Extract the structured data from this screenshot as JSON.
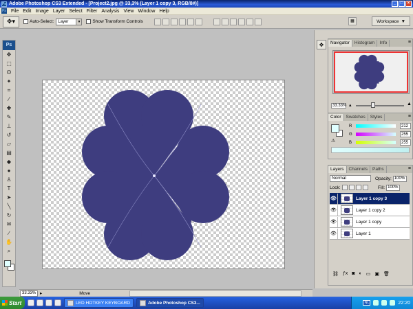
{
  "window": {
    "title": "Adobe Photoshop CS3 Extended - [Project2.jpg @ 33,3% (Layer 1 copy 3, RGB/8#)]"
  },
  "menu": [
    "File",
    "Edit",
    "Image",
    "Layer",
    "Select",
    "Filter",
    "Analysis",
    "View",
    "Window",
    "Help"
  ],
  "options": {
    "auto_select_label": "Auto-Select:",
    "auto_select_value": "Layer",
    "show_transform_label": "Show Transform Controls",
    "workspace_label": "Workspace"
  },
  "toolbox": {
    "logo": "Ps"
  },
  "document": {
    "zoom": "33.33%",
    "status": "Move",
    "shape_color": "#3e3d7f"
  },
  "navigator": {
    "tabs": [
      "Navigator",
      "Histogram",
      "Info"
    ],
    "zoom": "33.33%"
  },
  "color_panel": {
    "tabs": [
      "Color",
      "Swatches",
      "Styles"
    ],
    "channels": [
      {
        "label": "R",
        "value": "212"
      },
      {
        "label": "G",
        "value": "255"
      },
      {
        "label": "B",
        "value": "255"
      }
    ]
  },
  "layers_panel": {
    "tabs": [
      "Layers",
      "Channels",
      "Paths"
    ],
    "blend_mode": "Normal",
    "opacity_label": "Opacity:",
    "opacity": "100%",
    "lock_label": "Lock:",
    "fill_label": "Fill:",
    "fill": "100%",
    "layers": [
      {
        "name": "Layer 1 copy 3",
        "selected": true
      },
      {
        "name": "Layer 1 copy 2",
        "selected": false
      },
      {
        "name": "Layer 1 copy",
        "selected": false
      },
      {
        "name": "Layer 1",
        "selected": false
      }
    ]
  },
  "taskbar": {
    "start": "Start",
    "tasks": [
      "LED HOTKEY KEYBOARD",
      "Adobe Photoshop CS3..."
    ],
    "lang": "NL",
    "time": "22:20"
  }
}
